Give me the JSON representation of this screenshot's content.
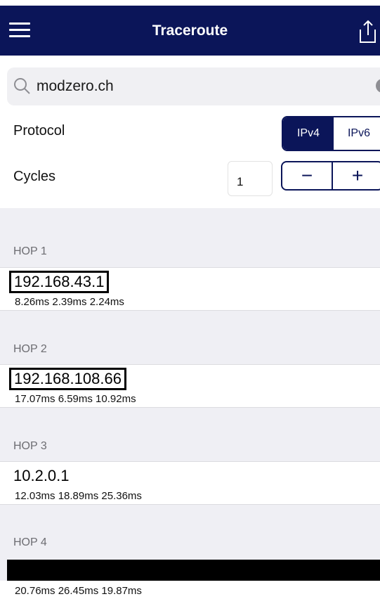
{
  "nav": {
    "title": "Traceroute"
  },
  "search": {
    "value": "modzero.ch",
    "clear_label": "✕"
  },
  "protocol": {
    "label": "Protocol",
    "options": [
      "IPv4",
      "IPv6"
    ],
    "selected": "IPv4"
  },
  "cycles": {
    "label": "Cycles",
    "value": "1",
    "minus_label": "−",
    "plus_label": "+"
  },
  "hops": [
    {
      "header": "HOP 1",
      "ip": "192.168.43.1",
      "times": "8.26ms 2.39ms 2.24ms",
      "highlight": "#f7e01b"
    },
    {
      "header": "HOP 2",
      "ip": "192.168.108.66",
      "times": "17.07ms 6.59ms 10.92ms",
      "highlight": "#d9202b"
    },
    {
      "header": "HOP 3",
      "ip": "10.2.0.1",
      "times": "12.03ms 18.89ms 25.36ms",
      "highlight": ""
    },
    {
      "header": "HOP 4",
      "ip": "",
      "times": "20.76ms 26.45ms 19.87ms",
      "highlight": ""
    }
  ],
  "colors": {
    "navbar": "#0b1559",
    "accent": "#0b1559",
    "background": "#efeff4"
  }
}
